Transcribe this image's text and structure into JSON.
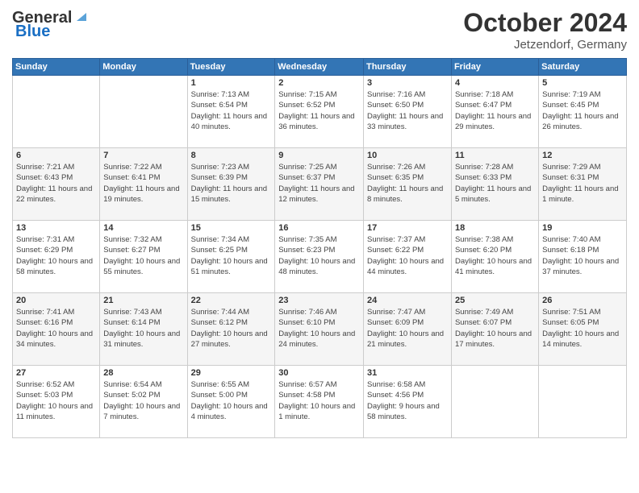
{
  "header": {
    "logo_line1": "General",
    "logo_line2": "Blue",
    "month": "October 2024",
    "location": "Jetzendorf, Germany"
  },
  "weekdays": [
    "Sunday",
    "Monday",
    "Tuesday",
    "Wednesday",
    "Thursday",
    "Friday",
    "Saturday"
  ],
  "weeks": [
    [
      {
        "day": "",
        "info": ""
      },
      {
        "day": "",
        "info": ""
      },
      {
        "day": "1",
        "info": "Sunrise: 7:13 AM\nSunset: 6:54 PM\nDaylight: 11 hours and 40 minutes."
      },
      {
        "day": "2",
        "info": "Sunrise: 7:15 AM\nSunset: 6:52 PM\nDaylight: 11 hours and 36 minutes."
      },
      {
        "day": "3",
        "info": "Sunrise: 7:16 AM\nSunset: 6:50 PM\nDaylight: 11 hours and 33 minutes."
      },
      {
        "day": "4",
        "info": "Sunrise: 7:18 AM\nSunset: 6:47 PM\nDaylight: 11 hours and 29 minutes."
      },
      {
        "day": "5",
        "info": "Sunrise: 7:19 AM\nSunset: 6:45 PM\nDaylight: 11 hours and 26 minutes."
      }
    ],
    [
      {
        "day": "6",
        "info": "Sunrise: 7:21 AM\nSunset: 6:43 PM\nDaylight: 11 hours and 22 minutes."
      },
      {
        "day": "7",
        "info": "Sunrise: 7:22 AM\nSunset: 6:41 PM\nDaylight: 11 hours and 19 minutes."
      },
      {
        "day": "8",
        "info": "Sunrise: 7:23 AM\nSunset: 6:39 PM\nDaylight: 11 hours and 15 minutes."
      },
      {
        "day": "9",
        "info": "Sunrise: 7:25 AM\nSunset: 6:37 PM\nDaylight: 11 hours and 12 minutes."
      },
      {
        "day": "10",
        "info": "Sunrise: 7:26 AM\nSunset: 6:35 PM\nDaylight: 11 hours and 8 minutes."
      },
      {
        "day": "11",
        "info": "Sunrise: 7:28 AM\nSunset: 6:33 PM\nDaylight: 11 hours and 5 minutes."
      },
      {
        "day": "12",
        "info": "Sunrise: 7:29 AM\nSunset: 6:31 PM\nDaylight: 11 hours and 1 minute."
      }
    ],
    [
      {
        "day": "13",
        "info": "Sunrise: 7:31 AM\nSunset: 6:29 PM\nDaylight: 10 hours and 58 minutes."
      },
      {
        "day": "14",
        "info": "Sunrise: 7:32 AM\nSunset: 6:27 PM\nDaylight: 10 hours and 55 minutes."
      },
      {
        "day": "15",
        "info": "Sunrise: 7:34 AM\nSunset: 6:25 PM\nDaylight: 10 hours and 51 minutes."
      },
      {
        "day": "16",
        "info": "Sunrise: 7:35 AM\nSunset: 6:23 PM\nDaylight: 10 hours and 48 minutes."
      },
      {
        "day": "17",
        "info": "Sunrise: 7:37 AM\nSunset: 6:22 PM\nDaylight: 10 hours and 44 minutes."
      },
      {
        "day": "18",
        "info": "Sunrise: 7:38 AM\nSunset: 6:20 PM\nDaylight: 10 hours and 41 minutes."
      },
      {
        "day": "19",
        "info": "Sunrise: 7:40 AM\nSunset: 6:18 PM\nDaylight: 10 hours and 37 minutes."
      }
    ],
    [
      {
        "day": "20",
        "info": "Sunrise: 7:41 AM\nSunset: 6:16 PM\nDaylight: 10 hours and 34 minutes."
      },
      {
        "day": "21",
        "info": "Sunrise: 7:43 AM\nSunset: 6:14 PM\nDaylight: 10 hours and 31 minutes."
      },
      {
        "day": "22",
        "info": "Sunrise: 7:44 AM\nSunset: 6:12 PM\nDaylight: 10 hours and 27 minutes."
      },
      {
        "day": "23",
        "info": "Sunrise: 7:46 AM\nSunset: 6:10 PM\nDaylight: 10 hours and 24 minutes."
      },
      {
        "day": "24",
        "info": "Sunrise: 7:47 AM\nSunset: 6:09 PM\nDaylight: 10 hours and 21 minutes."
      },
      {
        "day": "25",
        "info": "Sunrise: 7:49 AM\nSunset: 6:07 PM\nDaylight: 10 hours and 17 minutes."
      },
      {
        "day": "26",
        "info": "Sunrise: 7:51 AM\nSunset: 6:05 PM\nDaylight: 10 hours and 14 minutes."
      }
    ],
    [
      {
        "day": "27",
        "info": "Sunrise: 6:52 AM\nSunset: 5:03 PM\nDaylight: 10 hours and 11 minutes."
      },
      {
        "day": "28",
        "info": "Sunrise: 6:54 AM\nSunset: 5:02 PM\nDaylight: 10 hours and 7 minutes."
      },
      {
        "day": "29",
        "info": "Sunrise: 6:55 AM\nSunset: 5:00 PM\nDaylight: 10 hours and 4 minutes."
      },
      {
        "day": "30",
        "info": "Sunrise: 6:57 AM\nSunset: 4:58 PM\nDaylight: 10 hours and 1 minute."
      },
      {
        "day": "31",
        "info": "Sunrise: 6:58 AM\nSunset: 4:56 PM\nDaylight: 9 hours and 58 minutes."
      },
      {
        "day": "",
        "info": ""
      },
      {
        "day": "",
        "info": ""
      }
    ]
  ]
}
